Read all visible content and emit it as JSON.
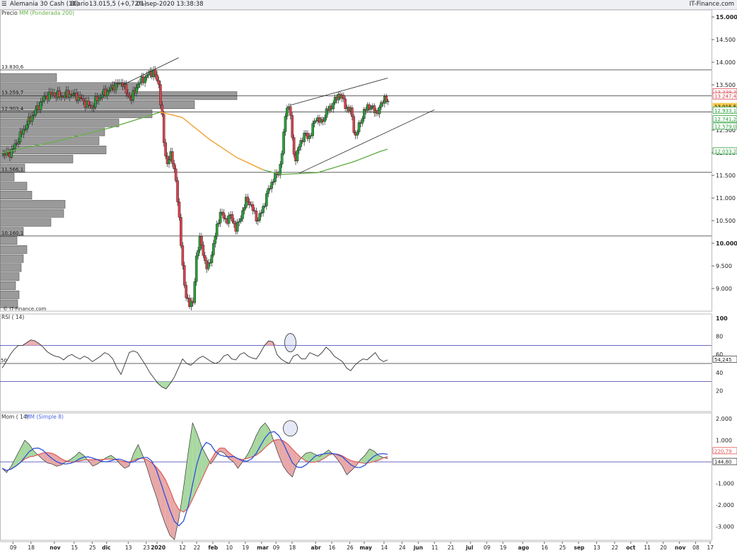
{
  "header": {
    "instrument": "Alemania 30 Cash (1€)",
    "period": "Diario",
    "last": "13.015,5 (+0,72%)",
    "datetime": "01-sep-2020 13:38:38",
    "source": "IT-Finance.com"
  },
  "watermark": "© IT-Finance.com",
  "chart_data": [
    {
      "type": "candlestick",
      "title": "",
      "legend": [
        "Precio",
        "MM (Ponderada 200)"
      ],
      "ylim": [
        8500,
        15000
      ],
      "yticks": [
        {
          "value": 15000,
          "label": "15.000"
        },
        {
          "value": 14500,
          "label": "14.500"
        },
        {
          "value": 14000,
          "label": "14.000"
        },
        {
          "value": 13500,
          "label": "13.500"
        },
        {
          "value": 12500,
          "label": "12.500"
        },
        {
          "value": 12000,
          "label": "12.000"
        },
        {
          "value": 11500,
          "label": "11.500"
        },
        {
          "value": 11000,
          "label": "11.000"
        },
        {
          "value": 10500,
          "label": "10.500"
        },
        {
          "value": 10000,
          "label": "10.000"
        },
        {
          "value": 9500,
          "label": "9.500"
        },
        {
          "value": 9000,
          "label": "9.000"
        }
      ],
      "price_path": [
        [
          0,
          11950
        ],
        [
          5,
          12000
        ],
        [
          9,
          12300
        ],
        [
          14,
          12650
        ],
        [
          19,
          12950
        ],
        [
          24,
          13250
        ],
        [
          28,
          13300
        ],
        [
          33,
          13250
        ],
        [
          37,
          13300
        ],
        [
          42,
          13250
        ],
        [
          46,
          13100
        ],
        [
          50,
          13000
        ],
        [
          52,
          13150
        ],
        [
          56,
          13300
        ],
        [
          60,
          13400
        ],
        [
          63,
          13500
        ],
        [
          67,
          13550
        ],
        [
          69,
          13300
        ],
        [
          72,
          13200
        ],
        [
          75,
          13500
        ],
        [
          79,
          13650
        ],
        [
          82,
          13750
        ],
        [
          84,
          13800
        ],
        [
          87,
          13500
        ],
        [
          89,
          12700
        ],
        [
          90,
          12100
        ],
        [
          91,
          11900
        ],
        [
          92,
          11700
        ],
        [
          93,
          12000
        ],
        [
          95,
          11750
        ],
        [
          96,
          11600
        ],
        [
          97,
          11100
        ],
        [
          99,
          10200
        ],
        [
          101,
          9100
        ],
        [
          102,
          8800
        ],
        [
          104,
          8700
        ],
        [
          106,
          8650
        ],
        [
          108,
          9800
        ],
        [
          110,
          10100
        ],
        [
          112,
          9700
        ],
        [
          114,
          9400
        ],
        [
          116,
          9700
        ],
        [
          118,
          10100
        ],
        [
          121,
          10700
        ],
        [
          124,
          10500
        ],
        [
          127,
          10600
        ],
        [
          130,
          10300
        ],
        [
          133,
          10650
        ],
        [
          136,
          11000
        ],
        [
          139,
          10750
        ],
        [
          142,
          10500
        ],
        [
          145,
          10800
        ],
        [
          148,
          11200
        ],
        [
          151,
          11450
        ],
        [
          154,
          11600
        ],
        [
          156,
          12200
        ],
        [
          157,
          12800
        ],
        [
          158,
          13050
        ],
        [
          160,
          12900
        ],
        [
          161,
          12300
        ],
        [
          163,
          11800
        ],
        [
          165,
          12200
        ],
        [
          168,
          12400
        ],
        [
          171,
          12350
        ],
        [
          174,
          12800
        ],
        [
          177,
          12650
        ],
        [
          180,
          12900
        ],
        [
          184,
          13100
        ],
        [
          187,
          13300
        ],
        [
          189,
          13200
        ],
        [
          191,
          13000
        ],
        [
          194,
          12900
        ],
        [
          196,
          12300
        ],
        [
          198,
          12600
        ],
        [
          200,
          12800
        ],
        [
          203,
          13050
        ],
        [
          206,
          12950
        ],
        [
          209,
          12900
        ],
        [
          212,
          13250
        ],
        [
          214,
          13100
        ],
        [
          215,
          13015
        ]
      ],
      "support_levels": [
        {
          "value": 13830.6,
          "label": "13.830,6"
        },
        {
          "value": 13259.7,
          "label": "13.259,7"
        },
        {
          "value": 12903.4,
          "label": "12.903,4"
        },
        {
          "value": 11566.1,
          "label": "11.566,1"
        },
        {
          "value": 10160.1,
          "label": "10.160,1"
        }
      ],
      "price_badges": [
        {
          "value": 13339.3,
          "label": "13.339,3",
          "color": "#d9414d"
        },
        {
          "value": 13247.4,
          "label": "13.247,4",
          "color": "#d9414d"
        },
        {
          "value": 13015.5,
          "label": "13.015,5",
          "color": "#f2c94c"
        },
        {
          "value": 12933.1,
          "label": "12.933,1",
          "color": "#2a9d3a"
        },
        {
          "value": 12741.2,
          "label": "12.741,2",
          "color": "#2a9d3a"
        },
        {
          "value": 12579.0,
          "label": "12.579,0",
          "color": "#2a9d3a"
        },
        {
          "value": 12033.2,
          "label": "12.033,2",
          "color": "#2a9d3a"
        }
      ],
      "volume_profile": [
        {
          "level": 13650,
          "width": 80
        },
        {
          "level": 13450,
          "width": 195
        },
        {
          "level": 13250,
          "width": 335
        },
        {
          "level": 13050,
          "width": 275
        },
        {
          "level": 12850,
          "width": 215
        },
        {
          "level": 12650,
          "width": 168
        },
        {
          "level": 12450,
          "width": 148
        },
        {
          "level": 12250,
          "width": 140
        },
        {
          "level": 12050,
          "width": 150
        },
        {
          "level": 11850,
          "width": 103
        },
        {
          "level": 11650,
          "width": 35
        },
        {
          "level": 11450,
          "width": 20
        },
        {
          "level": 11250,
          "width": 38
        },
        {
          "level": 11050,
          "width": 45
        },
        {
          "level": 10850,
          "width": 92
        },
        {
          "level": 10650,
          "width": 90
        },
        {
          "level": 10450,
          "width": 72
        },
        {
          "level": 10250,
          "width": 33
        },
        {
          "level": 10050,
          "width": 24
        },
        {
          "level": 9850,
          "width": 38
        },
        {
          "level": 9650,
          "width": 33
        },
        {
          "level": 9450,
          "width": 30
        },
        {
          "level": 9250,
          "width": 27
        },
        {
          "level": 9050,
          "width": 22
        },
        {
          "level": 8850,
          "width": 27
        },
        {
          "level": 8650,
          "width": 25
        }
      ],
      "ma200": [
        [
          0,
          12000
        ],
        [
          30,
          12250
        ],
        [
          60,
          12550
        ],
        [
          88,
          12900
        ],
        [
          100,
          12780
        ],
        [
          115,
          12300
        ],
        [
          130,
          11900
        ],
        [
          145,
          11620
        ],
        [
          155,
          11520
        ],
        [
          175,
          11560
        ],
        [
          195,
          11800
        ],
        [
          210,
          12030
        ],
        [
          214,
          12080
        ]
      ]
    },
    {
      "type": "line",
      "title": "",
      "legend": [
        "RSI ( 14)"
      ],
      "ylim": [
        0,
        100
      ],
      "yticks": [
        {
          "value": 100,
          "label": "100"
        },
        {
          "value": 80,
          "label": "80"
        },
        {
          "value": 60,
          "label": "60"
        },
        {
          "value": 40,
          "label": "40"
        },
        {
          "value": 20,
          "label": "20"
        }
      ],
      "levels": [
        70,
        50,
        30
      ],
      "left_label": "50",
      "last_label": "54,245",
      "values": [
        45,
        52,
        60,
        66,
        70,
        70,
        73,
        76,
        75,
        72,
        68,
        63,
        60,
        58,
        57,
        54,
        58,
        60,
        57,
        55,
        58,
        56,
        52,
        55,
        58,
        62,
        60,
        55,
        45,
        38,
        50,
        62,
        64,
        62,
        55,
        48,
        40,
        34,
        28,
        24,
        22,
        28,
        35,
        45,
        55,
        50,
        48,
        52,
        56,
        58,
        55,
        52,
        50,
        52,
        58,
        60,
        55,
        54,
        60,
        62,
        58,
        56,
        55,
        62,
        70,
        75,
        74,
        60,
        55,
        52,
        50,
        58,
        60,
        55,
        55,
        62,
        60,
        58,
        62,
        68,
        64,
        58,
        55,
        52,
        45,
        42,
        48,
        52,
        55,
        54,
        58,
        62,
        55,
        52,
        54
      ]
    },
    {
      "type": "line",
      "title": "",
      "legend": [
        "Mom ( 14)",
        "MM (Simple 8)"
      ],
      "ylim": [
        -3500,
        2000
      ],
      "yticks": [
        {
          "value": 2000,
          "label": "2.000"
        },
        {
          "value": 1000,
          "label": "1.000"
        },
        {
          "value": -1000,
          "label": "-1.000"
        },
        {
          "value": -2000,
          "label": "-2.000"
        },
        {
          "value": -3000,
          "label": "-3.000"
        }
      ],
      "last_labels": {
        "ma": "220,79",
        "mom": "144,80"
      },
      "values": [
        -300,
        -500,
        -200,
        200,
        600,
        1000,
        800,
        500,
        300,
        100,
        -50,
        -100,
        -200,
        -150,
        0,
        100,
        250,
        450,
        300,
        50,
        -200,
        -100,
        50,
        200,
        300,
        150,
        -100,
        -300,
        -200,
        400,
        800,
        300,
        -300,
        -1000,
        -1600,
        -2300,
        -2900,
        -3400,
        -3600,
        -2600,
        -1200,
        400,
        1800,
        1300,
        700,
        300,
        -100,
        200,
        500,
        400,
        150,
        0,
        -300,
        0,
        300,
        700,
        1200,
        1600,
        1800,
        1500,
        900,
        300,
        -200,
        -500,
        -700,
        -100,
        200,
        400,
        450,
        350,
        250,
        400,
        550,
        350,
        100,
        -200,
        -600,
        -400,
        -200,
        100,
        300,
        600,
        500,
        300,
        200,
        150
      ]
    }
  ],
  "xaxis": {
    "labels": [
      {
        "pos": 6,
        "label": "09"
      },
      {
        "pos": 16,
        "label": "18"
      },
      {
        "pos": 29,
        "label": "nov"
      },
      {
        "pos": 40,
        "label": "15"
      },
      {
        "pos": 50,
        "label": "25"
      },
      {
        "pos": 58,
        "label": "dic"
      },
      {
        "pos": 70,
        "label": "13"
      },
      {
        "pos": 80,
        "label": "23"
      },
      {
        "pos": 86,
        "label": "2020"
      },
      {
        "pos": 100,
        "label": "12"
      },
      {
        "pos": 108,
        "label": "22"
      },
      {
        "pos": 117,
        "label": "feb"
      },
      {
        "pos": 126,
        "label": "10"
      },
      {
        "pos": 135,
        "label": "19"
      },
      {
        "pos": 144,
        "label": "mar"
      },
      {
        "pos": 152,
        "label": "09"
      },
      {
        "pos": 161,
        "label": "18"
      },
      {
        "pos": 174,
        "label": "abr"
      },
      {
        "pos": 183,
        "label": "16"
      },
      {
        "pos": 193,
        "label": "26"
      },
      {
        "pos": 201,
        "label": "may"
      },
      {
        "pos": 212,
        "label": "14"
      },
      {
        "pos": 222,
        "label": "24"
      },
      {
        "pos": 231,
        "label": "jun"
      },
      {
        "pos": 240,
        "label": "11"
      },
      {
        "pos": 249,
        "label": "21"
      },
      {
        "pos": 260,
        "label": "jul"
      },
      {
        "pos": 269,
        "label": "09"
      },
      {
        "pos": 278,
        "label": "19"
      },
      {
        "pos": 289,
        "label": "ago"
      },
      {
        "pos": 301,
        "label": "16"
      },
      {
        "pos": 311,
        "label": "25"
      },
      {
        "pos": 320,
        "label": "sep"
      },
      {
        "pos": 330,
        "label": "13"
      },
      {
        "pos": 340,
        "label": "22"
      },
      {
        "pos": 349,
        "label": "oct"
      },
      {
        "pos": 358,
        "label": "11"
      },
      {
        "pos": 367,
        "label": "20"
      },
      {
        "pos": 376,
        "label": "nov"
      },
      {
        "pos": 385,
        "label": "08"
      },
      {
        "pos": 393,
        "label": "17"
      }
    ],
    "max": 395
  },
  "colors": {
    "up": "#2a9d3a",
    "down": "#d9414d",
    "ma200": "#6ab04c",
    "ma200_early": "#f0a030",
    "rsi_line": "#333333",
    "rsi_level": "#3a3ab0",
    "mom_line": "#2e4fd6",
    "mom_ma": "#e05050",
    "fill_pos": "#a8d8a0",
    "fill_neg": "#e8a8a8",
    "grid": "#888888"
  }
}
